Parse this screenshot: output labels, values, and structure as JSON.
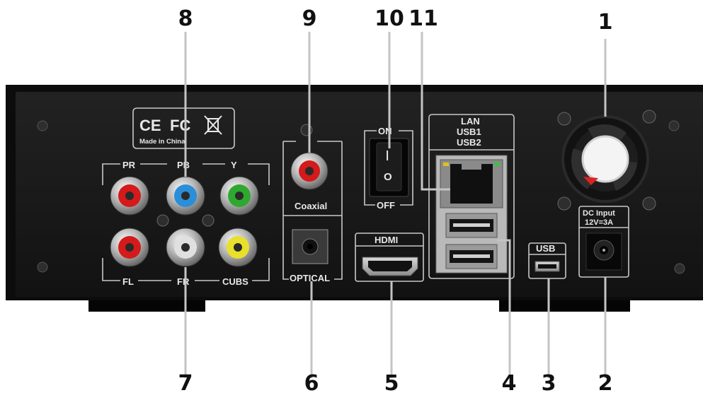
{
  "callout_numbers": [
    "1",
    "2",
    "3",
    "4",
    "5",
    "6",
    "7",
    "8",
    "9",
    "10",
    "11"
  ],
  "logos": {
    "ce": "CE",
    "fc": "FC",
    "made_in": "Made in China"
  },
  "labels": {
    "pr": "PR",
    "pb": "PB",
    "y": "Y",
    "fl": "FL",
    "fr": "FR",
    "cubs": "CUBS",
    "coaxial": "Coaxial",
    "optical": "OPTICAL",
    "on": "ON",
    "off": "OFF",
    "hdmi": "HDMI",
    "lan": "LAN",
    "usb1": "USB1",
    "usb2": "USB2",
    "usb": "USB",
    "dc_line1": "DC Input",
    "dc_line2": "12V=3A"
  },
  "connector_colors": {
    "pr": "#d41a1a",
    "pb": "#2a8fd8",
    "y": "#2ea82e",
    "fl": "#d41a1a",
    "fr": "#e0e0e0",
    "cubs": "#e8e02a",
    "coaxial": "#d41a1a"
  },
  "switch_glyphs": {
    "on_mark": "|",
    "off_mark": "O"
  },
  "icons": [
    "recycle-bin-icon",
    "fan-icon",
    "screw-icon"
  ]
}
